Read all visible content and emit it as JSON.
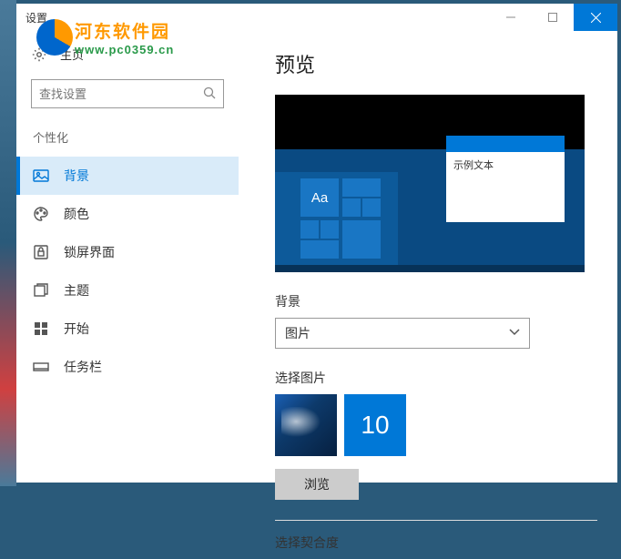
{
  "window": {
    "title": "设置"
  },
  "watermark": {
    "cn": "河东软件园",
    "en": "www.pc0359.cn"
  },
  "sidebar": {
    "home": "主页",
    "search_placeholder": "查找设置",
    "category": "个性化",
    "items": [
      {
        "label": "背景",
        "icon": "image-icon"
      },
      {
        "label": "颜色",
        "icon": "palette-icon"
      },
      {
        "label": "锁屏界面",
        "icon": "lock-icon"
      },
      {
        "label": "主题",
        "icon": "theme-icon"
      },
      {
        "label": "开始",
        "icon": "start-icon"
      },
      {
        "label": "任务栏",
        "icon": "taskbar-icon"
      }
    ]
  },
  "main": {
    "preview_heading": "预览",
    "preview_sample_text": "示例文本",
    "preview_aa": "Aa",
    "bg_label": "背景",
    "bg_dropdown_value": "图片",
    "choose_pic_label": "选择图片",
    "thumb_10": "10",
    "browse_btn": "浏览",
    "fit_label": "选择契合度"
  }
}
